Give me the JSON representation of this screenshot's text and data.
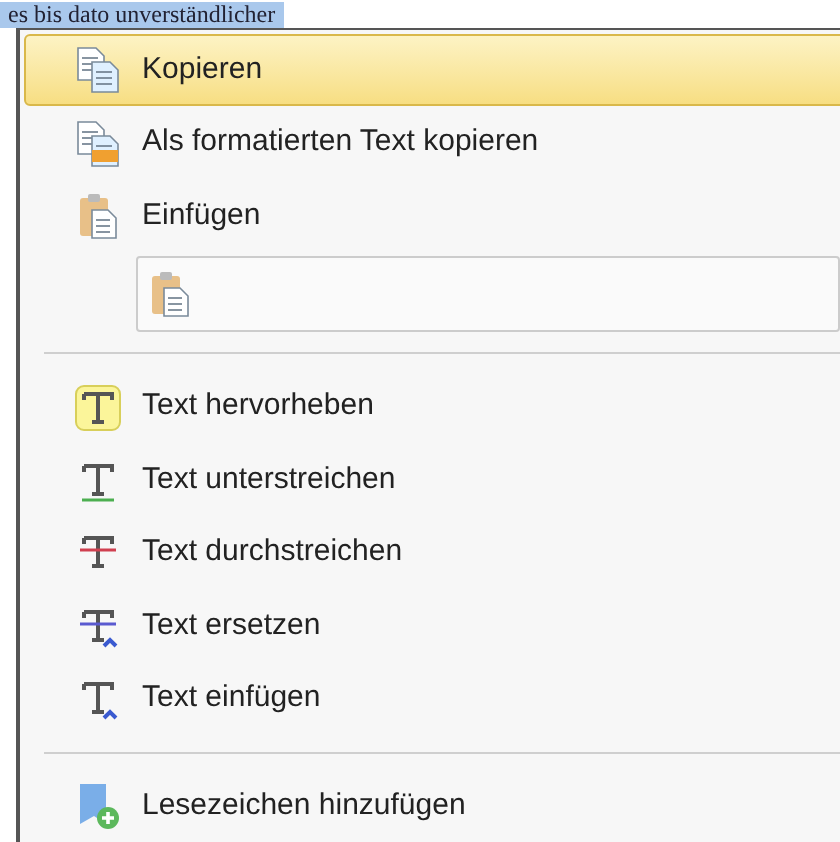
{
  "background_text": "es bis dato unverständlicher",
  "menu": [
    {
      "kind": "item",
      "label": "Kopieren",
      "selected": true
    },
    {
      "kind": "item",
      "label": "Als formatierten Text kopieren",
      "selected": false
    },
    {
      "kind": "item",
      "label": "Einfügen",
      "selected": false
    },
    {
      "kind": "paste-box"
    },
    {
      "kind": "separator"
    },
    {
      "kind": "item",
      "label": "Text hervorheben",
      "selected": false
    },
    {
      "kind": "item",
      "label": "Text unterstreichen",
      "selected": false
    },
    {
      "kind": "item",
      "label": "Text durchstreichen",
      "selected": false
    },
    {
      "kind": "item",
      "label": "Text ersetzen",
      "selected": false
    },
    {
      "kind": "item",
      "label": "Text einfügen",
      "selected": false
    },
    {
      "kind": "separator"
    },
    {
      "kind": "item",
      "label": "Lesezeichen hinzufügen",
      "selected": false
    }
  ]
}
